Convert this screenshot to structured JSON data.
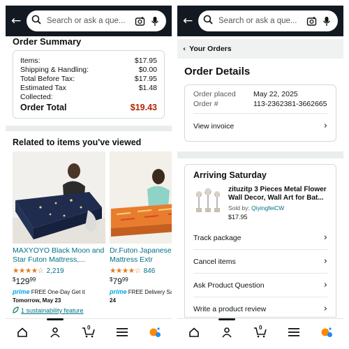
{
  "search": {
    "placeholder": "Search or ask a que..."
  },
  "left": {
    "summary": {
      "title": "Order Summary",
      "rows": [
        {
          "label": "Items:",
          "value": "$17.95"
        },
        {
          "label": "Shipping & Handling:",
          "value": "$0.00"
        },
        {
          "label": "Total Before Tax:",
          "value": "$17.95"
        },
        {
          "label": "Estimated Tax",
          "value": "$1.48"
        },
        {
          "label": "Collected:",
          "value": ""
        }
      ],
      "total_label": "Order Total",
      "total_value": "$19.43"
    },
    "related": {
      "title": "Related to items you've viewed",
      "products": [
        {
          "title": "MAXYOYO Black Moon and Star Futon Mattress,...",
          "rating_count": "2,219",
          "price_symbol": "$",
          "price_whole": "129",
          "price_cents": "99",
          "prime_label": "prime",
          "delivery_text": "FREE One-Day Get it",
          "delivery_date": "Tomorrow, May 23",
          "sustainability": "1 sustainability feature"
        },
        {
          "title": "Dr.Futon Japanese F Futon Mattress Extr",
          "rating_count": "846",
          "price_symbol": "$",
          "price_whole": "79",
          "price_cents": "99",
          "prime_label": "prime",
          "delivery_text": "FREE Delivery Sat",
          "delivery_date": "24"
        }
      ]
    }
  },
  "right": {
    "breadcrumb": "Your Orders",
    "page_title": "Order Details",
    "order_info": {
      "placed_label": "Order placed",
      "placed_value": "May 22, 2025",
      "number_label": "Order #",
      "number_value": "113-2362381-3662665",
      "invoice_link": "View invoice"
    },
    "shipment": {
      "title": "Arriving Saturday",
      "item_title": "zituzitp 3 Pieces Metal Flower Wall Decor, Wall Art for Bat...",
      "sold_by_label": "Sold by:",
      "sold_by_value": "QiyingfeiCW",
      "item_price": "$17.95",
      "actions": [
        "Track package",
        "Cancel items",
        "Ask Product Question",
        "Write a product review"
      ]
    }
  },
  "nav": {
    "cart_count": "0"
  },
  "colors": {
    "header": "#131921",
    "total_red": "#b12704",
    "link_teal": "#007185",
    "star_orange": "#de7921"
  },
  "icons": [
    "back-arrow-icon",
    "search-icon",
    "camera-icon",
    "mic-icon",
    "home-icon",
    "account-icon",
    "cart-icon",
    "menu-icon",
    "rufus-icon",
    "chevron-right-icon",
    "chevron-left-icon",
    "leaf-icon"
  ]
}
